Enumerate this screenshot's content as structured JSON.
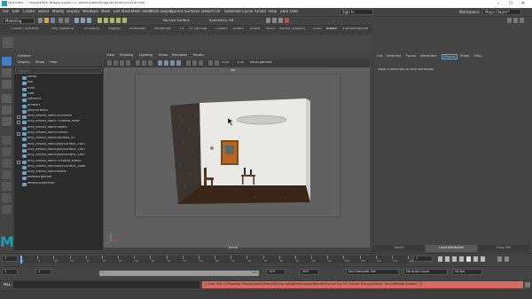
{
  "window": {
    "title": "untitled* - Autodesk Maya 2020: C:\\Users\\Desktop\\Scenes\\scene.mb",
    "minimize": "–",
    "maximize": "☐",
    "close": "✕"
  },
  "menubar": {
    "items": [
      "File",
      "Edit",
      "Create",
      "Select",
      "Modify",
      "Display",
      "Windows",
      "Mesh",
      "Edit Mesh",
      "Mesh Tools",
      "Mesh Display",
      "Curves",
      "Surfaces",
      "Deform",
      "UV",
      "Generate",
      "Cache",
      "Arnold",
      "Help",
      "Zero Tools"
    ],
    "mode": "Modeling",
    "surface_label": "No Live Surface",
    "symmetry": "Symmetry: Off",
    "sign_in": "Sign In",
    "workspace_label": "Workspace:",
    "workspace": "Maya Classic*"
  },
  "shelf": {
    "tabs": [
      "Curves / Surfaces",
      "Poly Modeling",
      "Sculpting",
      "Rigging",
      "Animation",
      "Rendering",
      "FX",
      "FX Caching",
      "Custom",
      "Arnold",
      "Bifrost",
      "MASH",
      "Motion Graphics",
      "XGen",
      "Arnold",
      "XGenInteractive"
    ],
    "active_index": 14
  },
  "outliner": {
    "title": "Outliner",
    "menu": [
      "Display",
      "Show",
      "Help"
    ],
    "search_placeholder": "Search...",
    "items": [
      {
        "label": "persp",
        "indent": 0,
        "expand": false
      },
      {
        "label": "top",
        "indent": 0,
        "expand": false
      },
      {
        "label": "front",
        "indent": 0,
        "expand": false
      },
      {
        "label": "side",
        "indent": 0,
        "expand": false
      },
      {
        "label": "camera1",
        "indent": 0,
        "expand": false
      },
      {
        "label": "pPlane1",
        "indent": 0,
        "expand": false
      },
      {
        "label": "polySurface1",
        "indent": 0,
        "expand": false
      },
      {
        "label": "only_arnold_room:Structure",
        "indent": 0,
        "expand": true
      },
      {
        "label": "only_arnold_room:TVStand_Base",
        "indent": 0,
        "expand": true
      },
      {
        "label": "only_arnold_room:Object",
        "indent": 0,
        "expand": false
      },
      {
        "label": "only_arnold_room:Frame1",
        "indent": 0,
        "expand": true
      },
      {
        "label": "only_arnold_room:Window_01",
        "indent": 0,
        "expand": false
      },
      {
        "label": "only_arnold_room:polySurface_1887",
        "indent": 0,
        "expand": false
      },
      {
        "label": "only_arnold_room:polySurface_1887",
        "indent": 0,
        "expand": false
      },
      {
        "label": "only_arnold_room:polySurface_1887",
        "indent": 0,
        "expand": false
      },
      {
        "label": "only_arnold_room:TVStand_Base1",
        "indent": 0,
        "expand": true
      },
      {
        "label": "only_arnold_room:polySurface_1886",
        "indent": 0,
        "expand": false
      },
      {
        "label": "only_arnold_room:Bottle",
        "indent": 0,
        "expand": false
      },
      {
        "label": "defaultLightSet",
        "indent": 0,
        "expand": false
      },
      {
        "label": "defaultObjectSet",
        "indent": 0,
        "expand": false
      }
    ]
  },
  "viewport": {
    "menu": [
      "View",
      "Shading",
      "Lighting",
      "Show",
      "Renderer",
      "Panels"
    ],
    "camera_label": "persp",
    "top_label": "top",
    "gamma": "sRGB gamma",
    "exposure": "0.00",
    "gamma_value": "1.00"
  },
  "attribute_editor": {
    "tabs": [
      "List",
      "Selected",
      "Focus",
      "Attributes",
      "Display",
      "Show",
      "Help"
    ],
    "active_tab": "Display",
    "message": "Make a selection to view attributes",
    "bottom_buttons": [
      "Select",
      "Load Attributes",
      "Copy Tab"
    ],
    "active_button": "Load Attributes"
  },
  "timeline": {
    "start": "1",
    "current_frame": "1",
    "ticks": [
      "1",
      "5",
      "10",
      "15",
      "20",
      "25",
      "30",
      "35",
      "40",
      "45",
      "50",
      "55",
      "60",
      "65",
      "70",
      "75",
      "80",
      "85",
      "90",
      "95",
      "100",
      "105",
      "110",
      "115",
      "120"
    ],
    "current_field": "1",
    "fps": "24 fps"
  },
  "range": {
    "start": "1",
    "inner_start": "1",
    "inner_end": "120",
    "end": "120",
    "anim_end": "200",
    "max": "200",
    "character_set": "No Character Set",
    "anim_layer": "No Anim Layer",
    "fps": "24 fps"
  },
  "commandline": {
    "language": "MEL",
    "error": "// Error: file: C:/Program Files/Autodesk/Maya2020/scripts/others/supportRenderers.mel line 19: Cannot find procedure \"arnoldRenderOptions\". //"
  }
}
